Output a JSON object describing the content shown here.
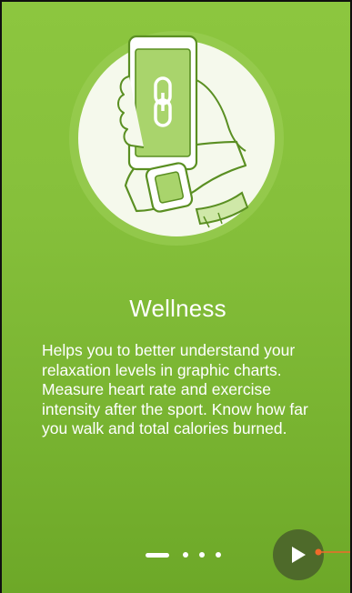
{
  "onboarding": {
    "title": "Wellness",
    "description": "Helps you to better understand your relaxation levels in graphic charts. Measure heart rate and exercise intensity after the sport. Know how far you walk and total calories burned.",
    "illustration_icon": "phone-watch-link-illustration",
    "pager": {
      "total_pages": 4,
      "current_page": 1
    },
    "next_icon": "play-arrow-icon",
    "accent_colors": {
      "background": "#86c03b",
      "circle": "#f4f9ea",
      "next_button": "#4e6a2a",
      "hint": "#f06a2a"
    }
  }
}
